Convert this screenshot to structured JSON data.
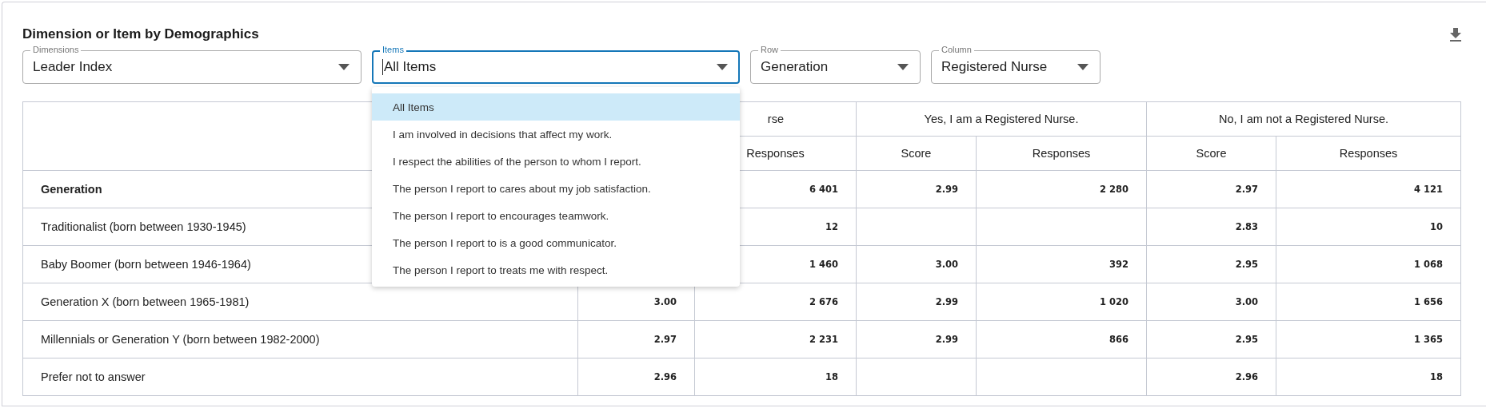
{
  "panel": {
    "title": "Dimension or Item by Demographics"
  },
  "filters": [
    {
      "label": "Dimensions",
      "value": "Leader Index",
      "focused": false
    },
    {
      "label": "Items",
      "value": "All Items",
      "focused": true
    },
    {
      "label": "Row",
      "value": "Generation",
      "focused": false
    },
    {
      "label": "Column",
      "value": "Registered Nurse",
      "focused": false
    }
  ],
  "items_menu": {
    "options": [
      {
        "label": "All Items",
        "selected": true
      },
      {
        "label": "I am involved in decisions that affect my work.",
        "selected": false
      },
      {
        "label": "I respect the abilities of the person to whom I report.",
        "selected": false
      },
      {
        "label": "The person I report to cares about my job satisfaction.",
        "selected": false
      },
      {
        "label": "The person I report to encourages teamwork.",
        "selected": false
      },
      {
        "label": "The person I report to is a good communicator.",
        "selected": false
      },
      {
        "label": "The person I report to treats me with respect.",
        "selected": false
      }
    ]
  },
  "table": {
    "groups": [
      "rse",
      "Yes, I am a Registered Nurse.",
      "No, I am not a Registered Nurse."
    ],
    "subheaders": [
      "Responses",
      "Score",
      "Responses",
      "Score",
      "Responses"
    ],
    "rows": [
      {
        "label": "Generation",
        "kind": "total",
        "cells": [
          null,
          "6 401",
          "2.99",
          "2 280",
          "2.97",
          "4 121"
        ]
      },
      {
        "label": "Traditionalist (born between 1930-1945)",
        "kind": "group",
        "cells": [
          null,
          "12",
          null,
          null,
          "2.83",
          "10"
        ]
      },
      {
        "label": "Baby Boomer (born between 1946-1964)",
        "kind": "group",
        "cells": [
          null,
          "1 460",
          "3.00",
          "392",
          "2.95",
          "1 068"
        ]
      },
      {
        "label": "Generation X (born between 1965-1981)",
        "kind": "group",
        "cells": [
          "3.00",
          "2 676",
          "2.99",
          "1 020",
          "3.00",
          "1 656"
        ]
      },
      {
        "label": "Millennials or Generation Y (born between 1982-2000)",
        "kind": "group",
        "cells": [
          "2.97",
          "2 231",
          "2.99",
          "866",
          "2.95",
          "1 365"
        ]
      },
      {
        "label": "Prefer not to answer",
        "kind": "group",
        "cells": [
          "2.96",
          "18",
          null,
          null,
          "2.96",
          "18"
        ]
      }
    ]
  }
}
